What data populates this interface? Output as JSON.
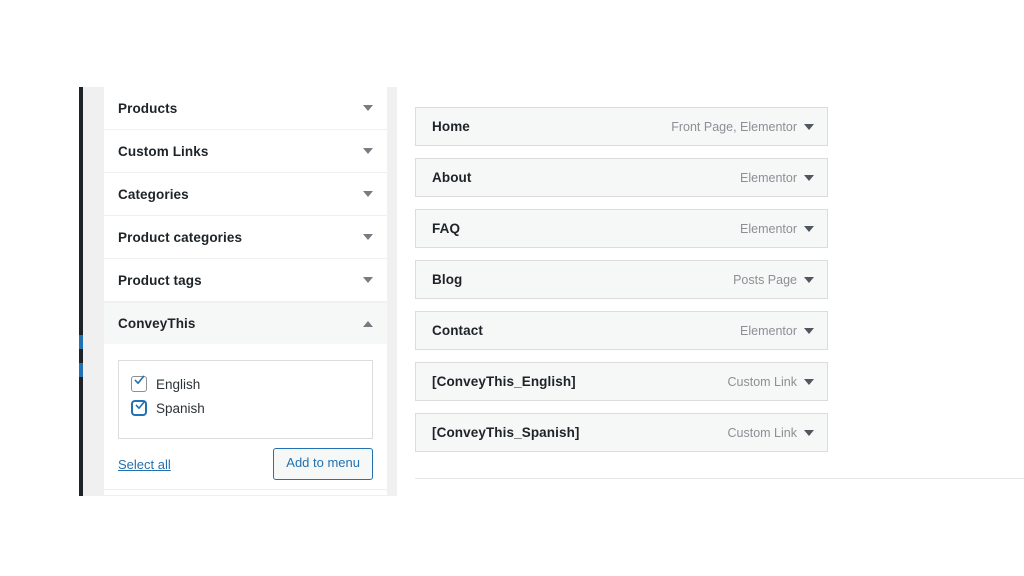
{
  "left_panel": {
    "sections": [
      {
        "label": "Products",
        "expanded": false,
        "toggle_icon": "chevron-down-icon"
      },
      {
        "label": "Custom Links",
        "expanded": false,
        "toggle_icon": "chevron-down-icon"
      },
      {
        "label": "Categories",
        "expanded": false,
        "toggle_icon": "chevron-down-icon"
      },
      {
        "label": "Product categories",
        "expanded": false,
        "toggle_icon": "chevron-down-icon"
      },
      {
        "label": "Product tags",
        "expanded": false,
        "toggle_icon": "chevron-down-icon"
      },
      {
        "label": "ConveyThis",
        "expanded": true,
        "toggle_icon": "chevron-up-icon"
      }
    ],
    "conveythis": {
      "checkboxes": [
        {
          "label": "English",
          "checked": true,
          "focused": false
        },
        {
          "label": "Spanish",
          "checked": true,
          "focused": true
        }
      ],
      "select_all_label": "Select all",
      "add_to_menu_label": "Add to menu"
    }
  },
  "menu_structure": {
    "items": [
      {
        "title": "Home",
        "type": "Front Page, Elementor",
        "toggle_icon": "chevron-down-icon"
      },
      {
        "title": "About",
        "type": "Elementor",
        "toggle_icon": "chevron-down-icon"
      },
      {
        "title": "FAQ",
        "type": "Elementor",
        "toggle_icon": "chevron-down-icon"
      },
      {
        "title": "Blog",
        "type": "Posts Page",
        "toggle_icon": "chevron-down-icon"
      },
      {
        "title": "Contact",
        "type": "Elementor",
        "toggle_icon": "chevron-down-icon"
      },
      {
        "title": "[ConveyThis_English]",
        "type": "Custom Link",
        "toggle_icon": "chevron-down-icon"
      },
      {
        "title": "[ConveyThis_Spanish]",
        "type": "Custom Link",
        "toggle_icon": "chevron-down-icon"
      }
    ]
  },
  "colors": {
    "accent_blue": "#2271b1",
    "admin_menu_dark": "#1d2327",
    "row_background": "#f6f7f7",
    "border_gray": "#dcdcde",
    "canvas_gray": "#f0f0f1",
    "muted_text": "#8c8f94"
  }
}
